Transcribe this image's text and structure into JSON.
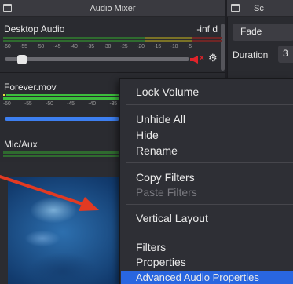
{
  "mixer": {
    "title": "Audio Mixer",
    "channels": [
      {
        "name": "Desktop Audio",
        "level": "-inf d"
      },
      {
        "name": "Forever.mov"
      },
      {
        "name": "Mic/Aux"
      }
    ],
    "tick_labels": [
      "-60",
      "-55",
      "-50",
      "-45",
      "-40",
      "-35",
      "-30",
      "-25",
      "-20",
      "-15",
      "-10",
      "-5"
    ],
    "tick_labels_short": [
      "-60",
      "-55",
      "-50",
      "-45",
      "-40",
      "-35"
    ]
  },
  "scenes": {
    "title": "Sc",
    "transition": "Fade",
    "duration_label": "Duration",
    "duration_value": "3"
  },
  "context_menu": {
    "items": [
      "Lock Volume",
      "Unhide All",
      "Hide",
      "Rename",
      "Copy Filters",
      "Paste Filters",
      "Vertical Layout",
      "Filters",
      "Properties",
      "Advanced Audio Properties"
    ],
    "disabled": [
      "Paste Filters"
    ],
    "highlighted": "Advanced Audio Properties"
  },
  "colors": {
    "accent": "#2966e0",
    "meter_green": "#3cbf3c",
    "meter_yellow": "#c2b52a",
    "meter_red": "#b43030",
    "annotation_arrow": "#e23a22"
  }
}
